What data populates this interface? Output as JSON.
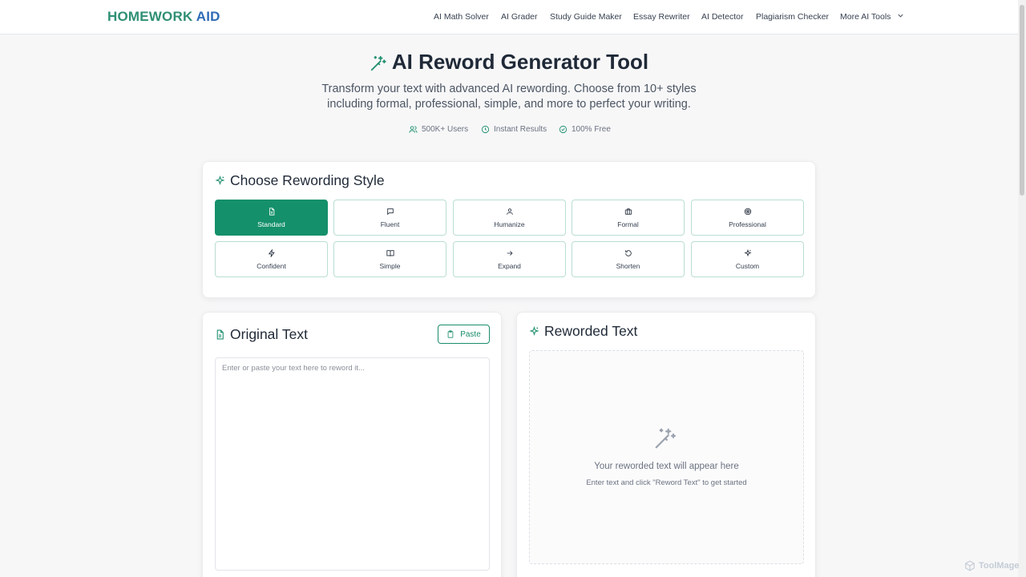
{
  "header": {
    "brand_part1": "HOMEWORK",
    "brand_part2": "AID",
    "nav": [
      {
        "label": "AI Math Solver"
      },
      {
        "label": "AI Grader"
      },
      {
        "label": "Study Guide Maker"
      },
      {
        "label": "Essay Rewriter"
      },
      {
        "label": "AI Detector"
      },
      {
        "label": "Plagiarism Checker"
      },
      {
        "label": "More AI Tools"
      }
    ]
  },
  "hero": {
    "title": "AI Reword Generator Tool",
    "subtitle": "Transform your text with advanced AI rewording. Choose from 10+ styles including formal, professional, simple, and more to perfect your writing.",
    "badges": [
      {
        "label": "500K+ Users",
        "icon": "users-icon"
      },
      {
        "label": "Instant Results",
        "icon": "clock-icon"
      },
      {
        "label": "100% Free",
        "icon": "check-circle-icon"
      }
    ]
  },
  "styles": {
    "title": "Choose Rewording Style",
    "selected": "Standard",
    "options": [
      {
        "label": "Standard",
        "icon": "document-icon"
      },
      {
        "label": "Fluent",
        "icon": "message-icon"
      },
      {
        "label": "Humanize",
        "icon": "person-icon"
      },
      {
        "label": "Formal",
        "icon": "briefcase-icon"
      },
      {
        "label": "Professional",
        "icon": "target-icon"
      },
      {
        "label": "Confident",
        "icon": "lightning-icon"
      },
      {
        "label": "Simple",
        "icon": "book-icon"
      },
      {
        "label": "Expand",
        "icon": "arrow-right-icon"
      },
      {
        "label": "Shorten",
        "icon": "rotate-icon"
      },
      {
        "label": "Custom",
        "icon": "sparkle-icon"
      }
    ]
  },
  "original": {
    "title": "Original Text",
    "paste_label": "Paste",
    "placeholder": "Enter or paste your text here to reword it...",
    "value": ""
  },
  "reworded": {
    "title": "Reworded Text",
    "empty_main": "Your reworded text will appear here",
    "empty_hint": "Enter text and click \"Reword Text\" to get started"
  },
  "watermark": "ToolMage",
  "colors": {
    "accent": "#14906a",
    "brand_green": "#2f8f74",
    "brand_blue": "#2f6bb8"
  }
}
